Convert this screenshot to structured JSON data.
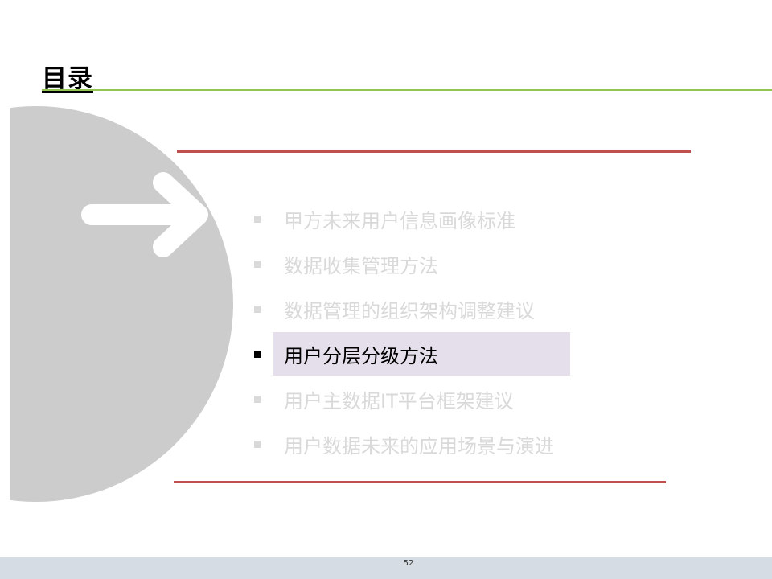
{
  "slide": {
    "title": "目录",
    "page_number": "52"
  },
  "toc": {
    "items": [
      {
        "label": "甲方未来用户信息画像标准",
        "active": false
      },
      {
        "label": "数据收集管理方法",
        "active": false
      },
      {
        "label": "数据管理的组织架构调整建议",
        "active": false
      },
      {
        "label": "用户分层分级方法",
        "active": true
      },
      {
        "label": "用户主数据IT平台框架建议",
        "active": false
      },
      {
        "label": "用户数据未来的应用场景与演进",
        "active": false
      }
    ]
  },
  "icons": {
    "arrow": "right-arrow-icon",
    "bullet": "square-bullet-icon"
  },
  "colors": {
    "title_rule": "#92c452",
    "section_rule": "#c0504d",
    "disc": "#cccccc",
    "arrow": "#ffffff",
    "inactive_text": "#d9d9d9",
    "active_text": "#000000",
    "active_highlight": "#e5dfec",
    "footer_bar": "#d6dce4"
  }
}
